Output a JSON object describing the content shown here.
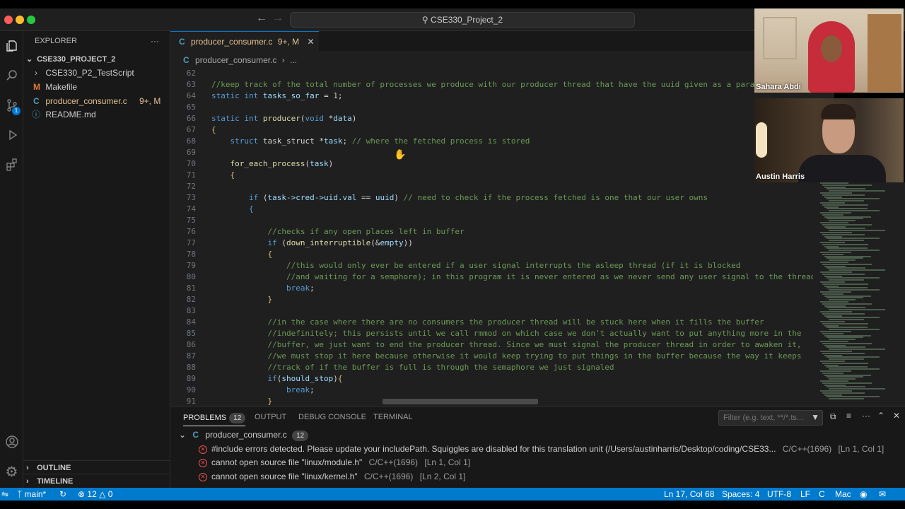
{
  "titlebar": {
    "search_text": "CSE330_Project_2"
  },
  "sidebar": {
    "title": "EXPLORER",
    "root": "CSE330_PROJECT_2",
    "items": [
      {
        "label": "CSE330_P2_TestScript",
        "kind": "folder"
      },
      {
        "label": "Makefile",
        "kind": "makefile",
        "icon_letter": "M"
      },
      {
        "label": "producer_consumer.c",
        "kind": "c",
        "icon_letter": "C",
        "badge": "9+, M"
      },
      {
        "label": "README.md",
        "kind": "info"
      }
    ],
    "outline": "OUTLINE",
    "timeline": "TIMELINE",
    "activity_badge": "1"
  },
  "editor": {
    "tab_icon": "C",
    "tab_label": "producer_consumer.c",
    "tab_badge": "9+, M",
    "breadcrumb_file": "producer_consumer.c",
    "breadcrumb_rest": "...",
    "lines": [
      {
        "n": "62",
        "segs": []
      },
      {
        "n": "63",
        "segs": [
          {
            "c": "cm",
            "t": "//keep track of the total number of processes we produce with our producer thread that have the uuid given as a parameter"
          }
        ]
      },
      {
        "n": "64",
        "segs": [
          {
            "c": "kw",
            "t": "static int "
          },
          {
            "c": "vr",
            "t": "tasks_so_far"
          },
          {
            "c": "tx",
            "t": " = "
          },
          {
            "c": "nu",
            "t": "1"
          },
          {
            "c": "tx",
            "t": ";"
          }
        ]
      },
      {
        "n": "65",
        "segs": []
      },
      {
        "n": "66",
        "segs": [
          {
            "c": "kw",
            "t": "static int "
          },
          {
            "c": "fn",
            "t": "producer"
          },
          {
            "c": "tx",
            "t": "("
          },
          {
            "c": "kw",
            "t": "void "
          },
          {
            "c": "tx",
            "t": "*"
          },
          {
            "c": "vr",
            "t": "data"
          },
          {
            "c": "tx",
            "t": ")"
          }
        ]
      },
      {
        "n": "67",
        "segs": [
          {
            "c": "pn",
            "t": "{"
          }
        ]
      },
      {
        "n": "68",
        "segs": [
          {
            "c": "tx",
            "t": "    "
          },
          {
            "c": "kw",
            "t": "struct "
          },
          {
            "c": "tx",
            "t": "task_struct *"
          },
          {
            "c": "vr",
            "t": "task"
          },
          {
            "c": "tx",
            "t": "; "
          },
          {
            "c": "cm",
            "t": "// where the fetched process is stored"
          }
        ]
      },
      {
        "n": "69",
        "segs": []
      },
      {
        "n": "70",
        "segs": [
          {
            "c": "tx",
            "t": "    "
          },
          {
            "c": "fn",
            "t": "for_each_process"
          },
          {
            "c": "tx",
            "t": "("
          },
          {
            "c": "vr",
            "t": "task"
          },
          {
            "c": "tx",
            "t": ")"
          }
        ]
      },
      {
        "n": "71",
        "segs": [
          {
            "c": "tx",
            "t": "    "
          },
          {
            "c": "pn",
            "t": "{"
          }
        ]
      },
      {
        "n": "72",
        "segs": []
      },
      {
        "n": "73",
        "segs": [
          {
            "c": "tx",
            "t": "        "
          },
          {
            "c": "kw",
            "t": "if "
          },
          {
            "c": "tx",
            "t": "("
          },
          {
            "c": "vr",
            "t": "task->cred->uid.val"
          },
          {
            "c": "tx",
            "t": " == "
          },
          {
            "c": "vr",
            "t": "uuid"
          },
          {
            "c": "tx",
            "t": ") "
          },
          {
            "c": "cm",
            "t": "// need to check if the process fetched is one that our user owns"
          }
        ]
      },
      {
        "n": "74",
        "segs": [
          {
            "c": "tx",
            "t": "        "
          },
          {
            "c": "kw",
            "t": "{"
          }
        ]
      },
      {
        "n": "75",
        "segs": []
      },
      {
        "n": "76",
        "segs": [
          {
            "c": "tx",
            "t": "            "
          },
          {
            "c": "cm",
            "t": "//checks if any open places left in buffer"
          }
        ]
      },
      {
        "n": "77",
        "segs": [
          {
            "c": "tx",
            "t": "            "
          },
          {
            "c": "kw",
            "t": "if "
          },
          {
            "c": "tx",
            "t": "("
          },
          {
            "c": "fn",
            "t": "down_interruptible"
          },
          {
            "c": "tx",
            "t": "(&"
          },
          {
            "c": "vr",
            "t": "empty"
          },
          {
            "c": "tx",
            "t": "))"
          }
        ]
      },
      {
        "n": "78",
        "segs": [
          {
            "c": "tx",
            "t": "            "
          },
          {
            "c": "pn",
            "t": "{"
          }
        ]
      },
      {
        "n": "79",
        "segs": [
          {
            "c": "tx",
            "t": "                "
          },
          {
            "c": "cm",
            "t": "//this would only ever be entered if a user signal interrupts the asleep thread (if it is blocked"
          }
        ]
      },
      {
        "n": "80",
        "segs": [
          {
            "c": "tx",
            "t": "                "
          },
          {
            "c": "cm",
            "t": "//and waiting for a semphore); in this program it is never entered as we never send any user signal to the threads"
          }
        ]
      },
      {
        "n": "81",
        "segs": [
          {
            "c": "tx",
            "t": "                "
          },
          {
            "c": "kw",
            "t": "break"
          },
          {
            "c": "tx",
            "t": ";"
          }
        ]
      },
      {
        "n": "82",
        "segs": [
          {
            "c": "tx",
            "t": "            "
          },
          {
            "c": "pn",
            "t": "}"
          }
        ]
      },
      {
        "n": "83",
        "segs": []
      },
      {
        "n": "84",
        "segs": [
          {
            "c": "tx",
            "t": "            "
          },
          {
            "c": "cm",
            "t": "//in the case where there are no consumers the producer thread will be stuck here when it fills the buffer"
          }
        ]
      },
      {
        "n": "85",
        "segs": [
          {
            "c": "tx",
            "t": "            "
          },
          {
            "c": "cm",
            "t": "//indefinitely; this persists until we call rmmod on which case we don't actually want to put anything more in the"
          }
        ]
      },
      {
        "n": "86",
        "segs": [
          {
            "c": "tx",
            "t": "            "
          },
          {
            "c": "cm",
            "t": "//buffer, we just want to end the producer thread. Since we must signal the producer thread in order to awaken it,"
          }
        ]
      },
      {
        "n": "87",
        "segs": [
          {
            "c": "tx",
            "t": "            "
          },
          {
            "c": "cm",
            "t": "//we must stop it here because otherwise it would keep trying to put things in the buffer because the way it keeps"
          }
        ]
      },
      {
        "n": "88",
        "segs": [
          {
            "c": "tx",
            "t": "            "
          },
          {
            "c": "cm",
            "t": "//track of if the buffer is full is through the semaphore we just signaled"
          }
        ]
      },
      {
        "n": "89",
        "segs": [
          {
            "c": "tx",
            "t": "            "
          },
          {
            "c": "kw",
            "t": "if"
          },
          {
            "c": "tx",
            "t": "("
          },
          {
            "c": "vr",
            "t": "should_stop"
          },
          {
            "c": "tx",
            "t": ")"
          },
          {
            "c": "pn",
            "t": "{"
          }
        ]
      },
      {
        "n": "90",
        "segs": [
          {
            "c": "tx",
            "t": "                "
          },
          {
            "c": "kw",
            "t": "break"
          },
          {
            "c": "tx",
            "t": ";"
          }
        ]
      },
      {
        "n": "91",
        "segs": [
          {
            "c": "tx",
            "t": "            "
          },
          {
            "c": "pn",
            "t": "}"
          }
        ]
      }
    ]
  },
  "video": {
    "participant_1": "Sahara Abdi",
    "participant_2": "Austin Harris"
  },
  "panel": {
    "tabs": [
      {
        "label": "PROBLEMS",
        "badge": "12"
      },
      {
        "label": "OUTPUT"
      },
      {
        "label": "DEBUG CONSOLE"
      },
      {
        "label": "TERMINAL"
      }
    ],
    "filter_placeholder": "Filter (e.g. text, **/*.ts...",
    "group_file": "producer_consumer.c",
    "group_count": "12",
    "problems": [
      {
        "msg": "#include errors detected. Please update your includePath. Squiggles are disabled for this translation unit (/Users/austinharris/Desktop/coding/CSE33...",
        "src": "C/C++(1696)",
        "loc": "[Ln 1, Col 1]"
      },
      {
        "msg": "cannot open source file \"linux/module.h\"",
        "src": "C/C++(1696)",
        "loc": "[Ln 1, Col 1]"
      },
      {
        "msg": "cannot open source file \"linux/kernel.h\"",
        "src": "C/C++(1696)",
        "loc": "[Ln 2, Col 1]"
      }
    ]
  },
  "statusbar": {
    "branch": "main*",
    "errors": "12",
    "warnings": "0",
    "position": "Ln 17, Col 68",
    "spaces": "Spaces: 4",
    "encoding": "UTF-8",
    "eol": "LF",
    "language": "C",
    "platform": "Mac"
  }
}
